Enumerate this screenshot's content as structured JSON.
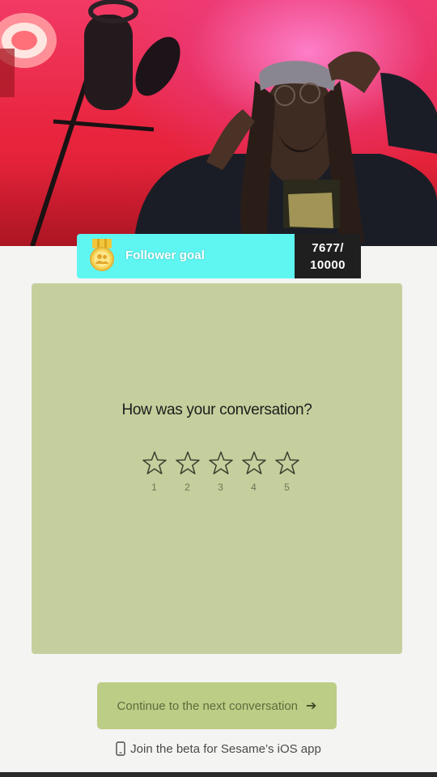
{
  "follower_goal": {
    "label": "Follower goal",
    "current": "7677/",
    "target": "10000",
    "icon": "medal-icon",
    "accent_color": "#5ff6f2"
  },
  "rating": {
    "question": "How was your conversation?",
    "stars": [
      {
        "number": "1"
      },
      {
        "number": "2"
      },
      {
        "number": "3"
      },
      {
        "number": "4"
      },
      {
        "number": "5"
      }
    ],
    "selected": 0,
    "card_color": "#c5cf9d"
  },
  "continue_button": {
    "label": "Continue to the next conversation",
    "icon": "arrow-right-icon"
  },
  "beta_link": {
    "label": "Join the beta for Sesame’s iOS app",
    "icon": "phone-icon"
  }
}
